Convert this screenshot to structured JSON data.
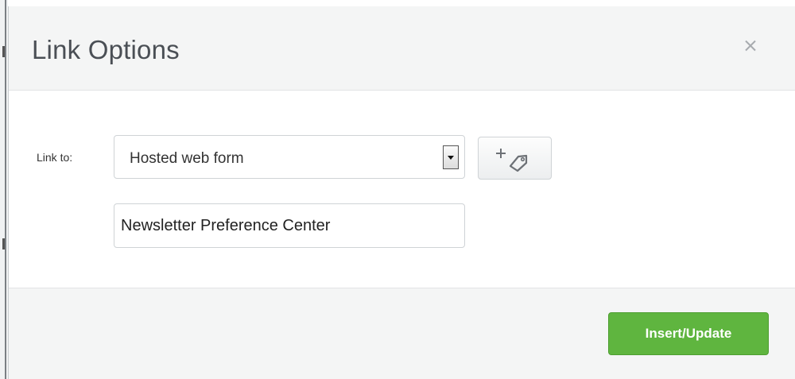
{
  "dialog": {
    "title": "Link Options",
    "close_icon": "close-icon"
  },
  "form": {
    "link_label": "Link to:",
    "link_type": {
      "selected": "Hosted web form",
      "icon": "chevron-down-icon"
    },
    "tag_button_icon": "add-tag-icon",
    "target_value": "Newsletter Preference Center"
  },
  "footer": {
    "submit_label": "Insert/Update"
  },
  "colors": {
    "primary": "#5fb53f",
    "header_bg": "#f4f5f5",
    "title": "#4a4f55"
  }
}
